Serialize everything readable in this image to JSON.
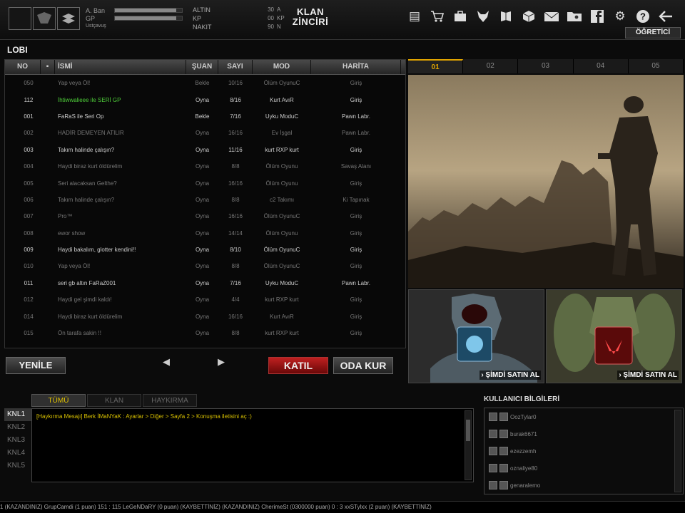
{
  "player": {
    "name": "A. Ban",
    "gp_label": "GP",
    "rank_label": "Ustçavuş",
    "xp_fill": 0.92,
    "gp_fill": 0.92
  },
  "currency": {
    "altin_label": "ALTIN",
    "kp_label": "KP",
    "nakit_label": "NAKIT"
  },
  "kp_box": {
    "rows": [
      {
        "value": "30",
        "label": "A"
      },
      {
        "value": "00",
        "label": "KP"
      },
      {
        "value": "90",
        "label": "N"
      }
    ]
  },
  "klan_button": {
    "line1": "KLAN",
    "line2": "ZİNCİRİ"
  },
  "top_icons": [
    "notebook-icon",
    "cart-icon",
    "bag-icon",
    "wolf-icon",
    "book-icon",
    "box-icon",
    "mail-icon",
    "folder-user-icon",
    "facebook-icon",
    "gear-icon",
    "help-icon",
    "back-arrow-icon"
  ],
  "ogretici_label": "ÖĞRETİCİ",
  "lobby": {
    "title": "LOBI",
    "columns": {
      "no": "NO",
      "name": "İSMİ",
      "state": "ŞUAN",
      "count": "SAYI",
      "mode": "MOD",
      "map": "HARİTA"
    },
    "rows": [
      {
        "no": "050",
        "name": "Yap veya Öl!",
        "state": "Bekle",
        "count": "10/16",
        "mode": "Ölüm OyunuC",
        "map": "Giriş",
        "hi": false
      },
      {
        "no": "112",
        "name": "İhtiwwalieee ile SERİ GP",
        "state": "Oyna",
        "count": "8/16",
        "mode": "Kurt AvıR",
        "map": "Giriş",
        "hi": true
      },
      {
        "no": "001",
        "name": "FaRaS ile Seri Op",
        "state": "Bekle",
        "count": "7/16",
        "mode": "Uyku ModuC",
        "map": "Pawn Labr.",
        "hi": true
      },
      {
        "no": "002",
        "name": "HADİR DEMEYEN ATILIR",
        "state": "Oyna",
        "count": "16/16",
        "mode": "Ev İşgal",
        "map": "Pawn Labr.",
        "hi": false
      },
      {
        "no": "003",
        "name": "Takım halinde çalışın?",
        "state": "Oyna",
        "count": "11/16",
        "mode": "kurt RXP kurt",
        "map": "Giriş",
        "hi": true
      },
      {
        "no": "004",
        "name": "Haydi biraz kurt öldürelim",
        "state": "Oyna",
        "count": "8/8",
        "mode": "Ölüm Oyunu",
        "map": "Savaş Alanı",
        "hi": false
      },
      {
        "no": "005",
        "name": "Seri alacaksan Gelthe?",
        "state": "Oyna",
        "count": "16/16",
        "mode": "Ölüm Oyunu",
        "map": "Giriş",
        "hi": false
      },
      {
        "no": "006",
        "name": "Takım halinde çalışın?",
        "state": "Oyna",
        "count": "8/8",
        "mode": "c2 Takımı",
        "map": "Ki Tapınak",
        "hi": false
      },
      {
        "no": "007",
        "name": "Pro™",
        "state": "Oyna",
        "count": "16/16",
        "mode": "Ölüm OyunuC",
        "map": "Giriş",
        "hi": false
      },
      {
        "no": "008",
        "name": "ewor show",
        "state": "Oyna",
        "count": "14/14",
        "mode": "Ölüm Oyunu",
        "map": "Giriş",
        "hi": false
      },
      {
        "no": "009",
        "name": "Haydi bakalım, glotter kendini!!",
        "state": "Oyna",
        "count": "8/10",
        "mode": "Ölüm OyunuC",
        "map": "Giriş",
        "hi": true
      },
      {
        "no": "010",
        "name": "Yap veya Öl!",
        "state": "Oyna",
        "count": "8/8",
        "mode": "Ölüm OyunuC",
        "map": "Giriş",
        "hi": false
      },
      {
        "no": "011",
        "name": "seri gb altın FaRaZ001",
        "state": "Oyna",
        "count": "7/16",
        "mode": "Uyku ModuC",
        "map": "Pawn Labr.",
        "hi": true
      },
      {
        "no": "012",
        "name": "Haydi gel şimdi kaldı!",
        "state": "Oyna",
        "count": "4/4",
        "mode": "kurt RXP kurt",
        "map": "Giriş",
        "hi": false
      },
      {
        "no": "014",
        "name": "Haydi biraz kurt öldürelim",
        "state": "Oyna",
        "count": "16/16",
        "mode": "Kurt AvıR",
        "map": "Giriş",
        "hi": false
      },
      {
        "no": "015",
        "name": "Ön tarafa sakin !!",
        "state": "Oyna",
        "count": "8/8",
        "mode": "kurt RXP kurt",
        "map": "Giriş",
        "hi": false
      }
    ],
    "buttons": {
      "refresh": "YENİLE",
      "join": "KATIL",
      "create": "ODA KUR",
      "prev": "◀",
      "next": "▶"
    }
  },
  "right_tabs": [
    "01",
    "02",
    "03",
    "04",
    "05"
  ],
  "promo": {
    "buy_label": "› ŞİMDİ SATIN AL"
  },
  "chat": {
    "tabs": [
      "TÜMÜ",
      "KLAN",
      "HAYKIRMA"
    ],
    "channels": [
      "KNL1",
      "KNL2",
      "KNL3",
      "KNL4",
      "KNL5"
    ],
    "message": "[Haykırma Mesajı]  Berk          İMaNYaK :  Ayarlar > Diğer > Sayfa 2 > Konuşma iletisini aç :)"
  },
  "user_info": {
    "title": "KULLANICI BİLGİLERİ",
    "users": [
      "OozTylar0",
      "burak6671",
      "ezezzemh",
      "oznaliye80",
      "genaralemo"
    ]
  },
  "status_text": "1  (KAZANDINIZ) GrupCamdi (1 puan) 151 : 115 LeGeNDaRY (0 puan) (KAYBETTİNİZ)          (KAZANDINIZ) CherimeSt (0300000 puan) 0 : 3 xxSTylxx (2 puan) (KAYBETTİNİZ)"
}
